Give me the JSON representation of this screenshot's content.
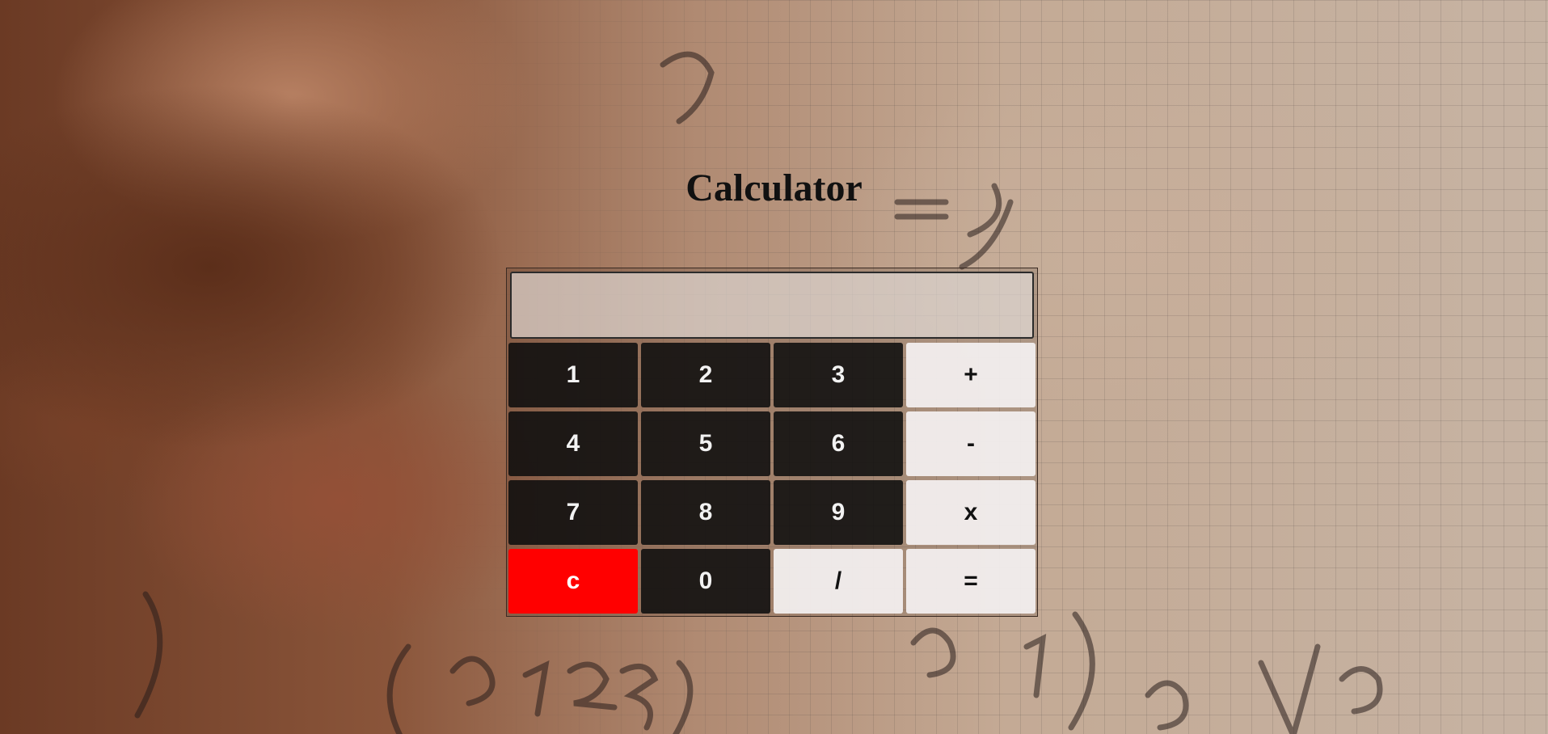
{
  "page": {
    "title": "Calculator"
  },
  "display": {
    "value": ""
  },
  "keys": [
    {
      "label": "1",
      "kind": "num"
    },
    {
      "label": "2",
      "kind": "num"
    },
    {
      "label": "3",
      "kind": "num"
    },
    {
      "label": "+",
      "kind": "op"
    },
    {
      "label": "4",
      "kind": "num"
    },
    {
      "label": "5",
      "kind": "num"
    },
    {
      "label": "6",
      "kind": "num"
    },
    {
      "label": "-",
      "kind": "op"
    },
    {
      "label": "7",
      "kind": "num"
    },
    {
      "label": "8",
      "kind": "num"
    },
    {
      "label": "9",
      "kind": "num"
    },
    {
      "label": "x",
      "kind": "op"
    },
    {
      "label": "c",
      "kind": "clear"
    },
    {
      "label": "0",
      "kind": "num"
    },
    {
      "label": "/",
      "kind": "op"
    },
    {
      "label": "=",
      "kind": "op"
    }
  ],
  "colors": {
    "number_key": "#0e0e0e",
    "operator_key": "#f2eeee",
    "clear_key": "#ff0000"
  }
}
